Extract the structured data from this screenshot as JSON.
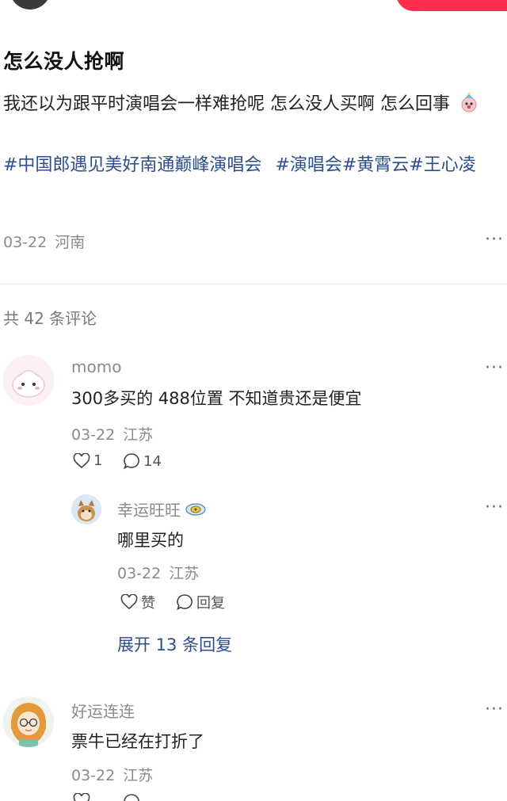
{
  "post": {
    "title": "怎么没人抢啊",
    "body": "我还以为跟平时演唱会一样难抢呢 怎么没人买啊 怎么回事",
    "tags": [
      "#中国郎遇见美好南通巅峰演唱会",
      "#演唱会",
      "#黄霄云",
      "#王心凌"
    ],
    "date": "03-22",
    "location": "河南",
    "more": "···"
  },
  "comments_header": {
    "label": "共 42 条评论"
  },
  "comments": [
    {
      "name": "momo",
      "text": "300多买的 488位置 不知道贵还是便宜",
      "date": "03-22",
      "location": "江苏",
      "likes": "1",
      "replies": "14",
      "more": "···",
      "reply": {
        "name": "幸运旺旺",
        "text": "哪里买的",
        "date": "03-22",
        "location": "江苏",
        "like_label": "赞",
        "reply_label": "回复",
        "more": "···"
      },
      "expand_label": "展开 13 条回复"
    },
    {
      "name": "好运连连",
      "text": "票牛已经在打折了",
      "date": "03-22",
      "location": "江苏",
      "more": "···"
    }
  ],
  "colors": {
    "accent": "#ff2e4d",
    "link": "#2b4e8c",
    "meta": "#8a8a8a"
  },
  "icons": [
    "heart-icon",
    "comment-bubble-icon",
    "more-icon",
    "badge-icon",
    "emoji-clown-icon"
  ]
}
